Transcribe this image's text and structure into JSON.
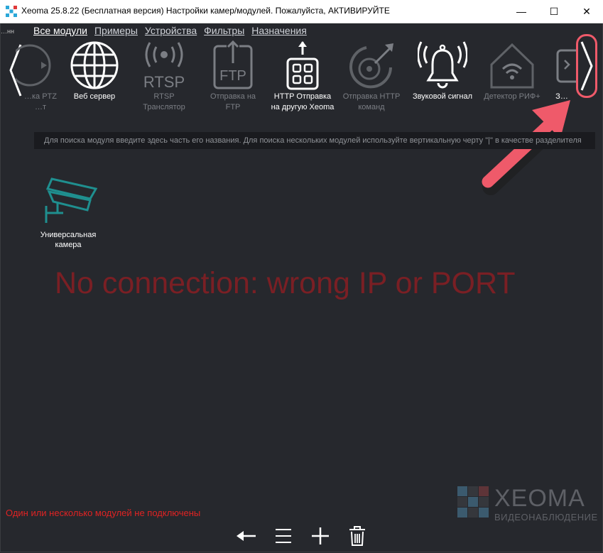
{
  "window": {
    "title": "Xeoma 25.8.22 (Бесплатная версия) Настройки камер/модулей. Пожалуйста, АКТИВИРУЙТЕ",
    "minimize": "—",
    "maximize": "☐",
    "close": "✕"
  },
  "nav": {
    "clipped": "…нн",
    "items": [
      "Все модули",
      "Примеры",
      "Устройства",
      "Фильтры",
      "Назначения"
    ]
  },
  "modules": [
    {
      "line1": "…ка PTZ",
      "line2": "…т"
    },
    {
      "line1": "Веб сервер",
      "line2": ""
    },
    {
      "line1": "RTSP",
      "line2": "Транслятор",
      "icon_text": "RTSP"
    },
    {
      "line1": "Отправка на",
      "line2": "FTP",
      "icon_text": "FTP"
    },
    {
      "line1": "HTTP Отправка",
      "line2": "на другую Xeoma"
    },
    {
      "line1": "Отправка HTTP",
      "line2": "команд"
    },
    {
      "line1": "Звуковой сигнал",
      "line2": ""
    },
    {
      "line1": "Детектор РИФ+",
      "line2": ""
    },
    {
      "line1": "З…",
      "line2": ""
    }
  ],
  "search": {
    "placeholder": "Для поиска модуля введите здесь часть его названия. Для поиска нескольких модулей используйте вертикальную черту \"|\" в качестве разделителя"
  },
  "workspace": {
    "camera_label_1": "Универсальная",
    "camera_label_2": "камера",
    "error": "No connection: wrong IP or PORT"
  },
  "status": "Один или несколько модулей не подключены",
  "logo": {
    "brand": "XEOMA",
    "sub": "ВИДЕОНАБЛЮДЕНИЕ"
  },
  "colors": {
    "background": "#26282d",
    "error_text": "#7a1f24",
    "status_text": "#e02323",
    "highlight": "#ef5a6a",
    "camera_icon": "#1f8f8f"
  },
  "icons": {
    "toolbar": [
      "back-arrow-icon",
      "menu-icon",
      "plus-icon",
      "trash-icon"
    ]
  }
}
